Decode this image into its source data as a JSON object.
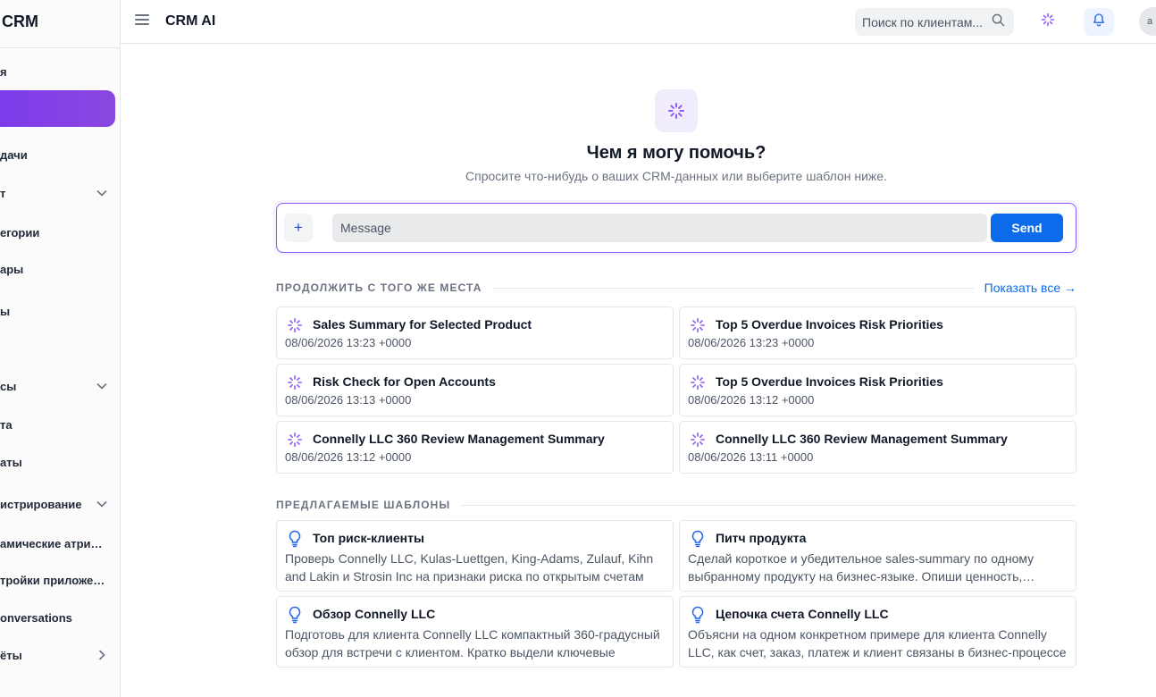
{
  "sidebar": {
    "brand": "CRM",
    "items": [
      {
        "label": "я",
        "chevron": ""
      },
      {
        "label": "дачи",
        "chevron": ""
      },
      {
        "label": "т",
        "chevron": "down"
      },
      {
        "label": "егории",
        "chevron": ""
      },
      {
        "label": "ары",
        "chevron": ""
      },
      {
        "label": "ы",
        "chevron": ""
      },
      {
        "label": "сы",
        "chevron": "down"
      },
      {
        "label": "та",
        "chevron": ""
      },
      {
        "label": "аты",
        "chevron": ""
      },
      {
        "label": "истрирование",
        "chevron": "down"
      },
      {
        "label": "амические атри…",
        "chevron": ""
      },
      {
        "label": "тройки приложе…",
        "chevron": ""
      },
      {
        "label": "onversations",
        "chevron": ""
      },
      {
        "label": "ёты",
        "chevron": "right"
      }
    ]
  },
  "header": {
    "title": "CRM AI",
    "search_placeholder": "Поиск по клиентам...",
    "avatar_initial": "a"
  },
  "hero": {
    "title": "Чем я могу помочь?",
    "subtitle": "Спросите что-нибудь о ваших CRM-данных или выберите шаблон ниже."
  },
  "composer": {
    "plus_label": "+",
    "placeholder": "Message",
    "send_label": "Send"
  },
  "recent": {
    "title": "ПРОДОЛЖИТЬ С ТОГО ЖЕ МЕСТА",
    "show_all": "Показать все →",
    "items": [
      {
        "title": "Sales Summary for Selected Product",
        "date": "08/06/2026 13:23 +0000"
      },
      {
        "title": "Top 5 Overdue Invoices Risk Priorities",
        "date": "08/06/2026 13:23 +0000"
      },
      {
        "title": "Risk Check for Open Accounts",
        "date": "08/06/2026 13:13 +0000"
      },
      {
        "title": "Top 5 Overdue Invoices Risk Priorities",
        "date": "08/06/2026 13:12 +0000"
      },
      {
        "title": "Connelly LLC 360 Review Management Summary",
        "date": "08/06/2026 13:12 +0000"
      },
      {
        "title": "Connelly LLC 360 Review Management Summary",
        "date": "08/06/2026 13:11 +0000"
      }
    ]
  },
  "templates": {
    "title": "ПРЕДЛАГАЕМЫЕ ШАБЛОНЫ",
    "items": [
      {
        "title": "Топ риск-клиенты",
        "desc": "Проверь Connelly LLC, Kulas-Luettgen, King-Adams, Zulauf, Kihn and Lakin и Strosin Inc на признаки риска по открытым счетам"
      },
      {
        "title": "Питч продукта",
        "desc": "Сделай короткое и убедительное sales-summary по одному выбранному продукту на бизнес-языке. Опиши ценность, преимущества"
      },
      {
        "title": "Обзор Connelly LLC",
        "desc": "Подготовь для клиента Connelly LLC компактный 360-градусный обзор для встречи с клиентом. Кратко выдели ключевые"
      },
      {
        "title": "Цепочка счета Connelly LLC",
        "desc": "Объясни на одном конкретном примере для клиента Connelly LLC, как счет, заказ, платеж и клиент связаны в бизнес-процессе"
      }
    ]
  },
  "colors": {
    "accent_purple": "#7c3aed",
    "primary_blue": "#0b6bea",
    "bulb_blue": "#2563eb"
  }
}
